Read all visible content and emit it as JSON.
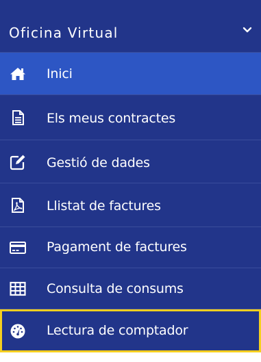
{
  "menu": {
    "title": "Oficina Virtual",
    "items": [
      {
        "label": "Inici",
        "icon": "home-icon"
      },
      {
        "label": "Els meus contractes",
        "icon": "document-icon"
      },
      {
        "label": "Gestió de dades",
        "icon": "edit-icon"
      },
      {
        "label": "Llistat de factures",
        "icon": "pdf-file-icon"
      },
      {
        "label": "Pagament de factures",
        "icon": "credit-card-icon"
      },
      {
        "label": "Consulta de consums",
        "icon": "table-icon"
      },
      {
        "label": "Lectura de comptador",
        "icon": "dashboard-meter-icon"
      }
    ],
    "active_item": "Inici",
    "highlighted_item": "Lectura de comptador"
  },
  "colors": {
    "menu_background": "#22358a",
    "active_background": "#2d56c4",
    "highlight_border": "#f5cf1f",
    "text": "#ffffff"
  }
}
